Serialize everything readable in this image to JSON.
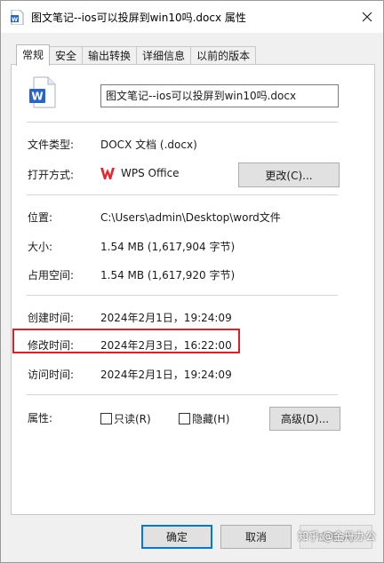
{
  "window": {
    "title": "图文笔记--ios可以投屏到win10吗.docx 属性"
  },
  "tabs": [
    {
      "label": "常规",
      "active": true
    },
    {
      "label": "安全",
      "active": false
    },
    {
      "label": "输出转换",
      "active": false
    },
    {
      "label": "详细信息",
      "active": false
    },
    {
      "label": "以前的版本",
      "active": false
    }
  ],
  "file": {
    "name": "图文笔记--ios可以投屏到win10吗.docx",
    "icon": "word-doc-icon"
  },
  "type_row": {
    "label": "文件类型:",
    "value": "DOCX 文档 (.docx)"
  },
  "open_with": {
    "label": "打开方式:",
    "app": "WPS Office",
    "change_button": "更改(C)..."
  },
  "location": {
    "label": "位置:",
    "value": "C:\\Users\\admin\\Desktop\\word文件"
  },
  "size": {
    "label": "大小:",
    "value": "1.54 MB (1,617,904 字节)"
  },
  "disk_size": {
    "label": "占用空间:",
    "value": "1.54 MB (1,617,920 字节)"
  },
  "created": {
    "label": "创建时间:",
    "value": "2024年2月1日，19:24:09"
  },
  "modified": {
    "label": "修改时间:",
    "value": "2024年2月3日，16:22:00"
  },
  "accessed": {
    "label": "访问时间:",
    "value": "2024年2月1日，19:24:09"
  },
  "attributes": {
    "label": "属性:",
    "readonly": "只读(R)",
    "readonly_checked": false,
    "hidden": "隐藏(H)",
    "hidden_checked": false,
    "advanced_button": "高级(D)..."
  },
  "footer": {
    "ok": "确定",
    "cancel": "取消",
    "apply": "应用(A)"
  },
  "watermark": "知乎 @金丹办公",
  "colors": {
    "highlight": "#d9212c",
    "wps_red": "#e8242c",
    "word_blue": "#2b64c8"
  }
}
